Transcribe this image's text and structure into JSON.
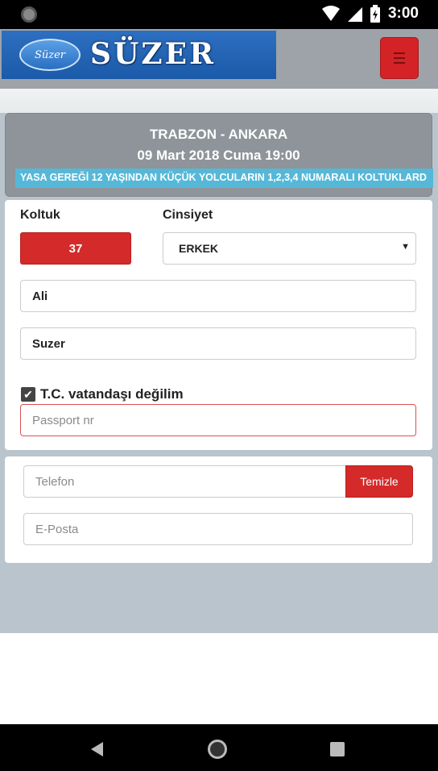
{
  "status_bar": {
    "time": "3:00"
  },
  "header": {
    "logo_script": "Süzer",
    "logo_text": "SÜZER"
  },
  "trip": {
    "route": "TRABZON - ANKARA",
    "datetime": "09 Mart 2018 Cuma 19:00",
    "notice": "YASA GEREĞİ 12 YAŞINDAN KÜÇÜK YOLCULARIN 1,2,3,4 NUMARALI KOLTUKLARD"
  },
  "passenger": {
    "seat_label": "Koltuk",
    "seat_value": "37",
    "gender_label": "Cinsiyet",
    "gender_value": "ERKEK",
    "first_name": "Ali",
    "last_name": "Suzer",
    "non_citizen_label": "T.C. vatandaşı değilim",
    "non_citizen_checked": true,
    "passport_placeholder": "Passport nr"
  },
  "contact": {
    "phone_placeholder": "Telefon",
    "clear_label": "Temizle",
    "email_placeholder": "E-Posta"
  },
  "colors": {
    "accent_red": "#d42a2a",
    "ticker_blue": "#56b8d8",
    "header_blue": "#1b5aa8"
  }
}
